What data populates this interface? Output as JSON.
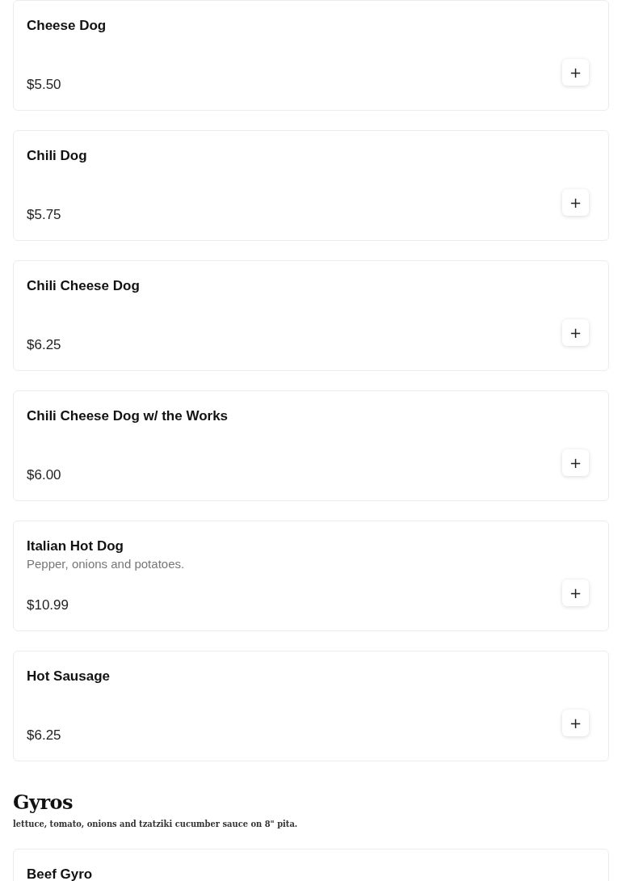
{
  "sections": [
    {
      "items": [
        {
          "name": "Cheese Dog",
          "price": "$5.50",
          "add_button": "+"
        },
        {
          "name": "Chili Dog",
          "price": "$5.75",
          "add_button": "+"
        },
        {
          "name": "Chili Cheese Dog",
          "price": "$6.25",
          "add_button": "+"
        },
        {
          "name": "Chili Cheese Dog w/ the Works",
          "price": "$6.00",
          "add_button": "+"
        },
        {
          "name": "Italian Hot Dog",
          "description": "Pepper, onions and potatoes.",
          "price": "$10.99",
          "add_button": "+"
        },
        {
          "name": "Hot Sausage",
          "price": "$6.25",
          "add_button": "+"
        }
      ]
    },
    {
      "title": "Gyros",
      "description": "lettuce, tomato, onions and tzatziki cucumber sauce on 8\" pita.",
      "items": [
        {
          "name": "Beef Gyro"
        }
      ]
    }
  ]
}
